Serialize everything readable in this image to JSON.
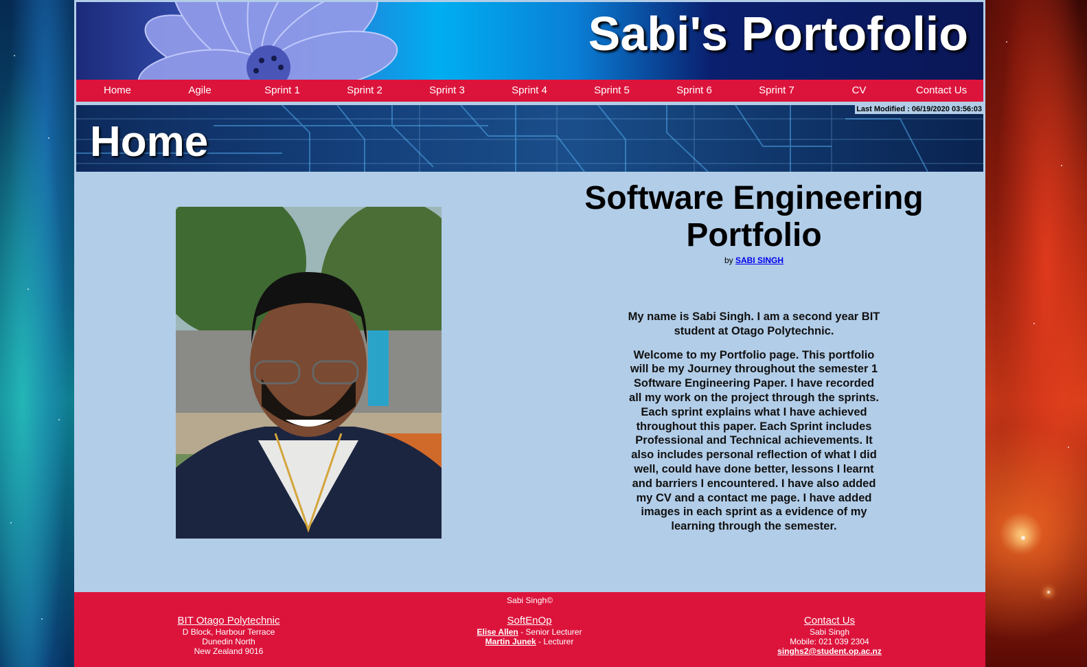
{
  "banner": {
    "title": "Sabi's Portofolio"
  },
  "nav": [
    {
      "label": "Home"
    },
    {
      "label": "Agile"
    },
    {
      "label": "Sprint 1"
    },
    {
      "label": "Sprint 2"
    },
    {
      "label": "Sprint 3"
    },
    {
      "label": "Sprint 4"
    },
    {
      "label": "Sprint 5"
    },
    {
      "label": "Sprint 6"
    },
    {
      "label": "Sprint 7"
    },
    {
      "label": "CV"
    },
    {
      "label": "Contact Us"
    }
  ],
  "hero": {
    "title": "Home",
    "last_modified": "Last Modified : 06/19/2020 03:56:03"
  },
  "content": {
    "heading": "Software Engineering Portfolio",
    "by_prefix": "by",
    "author_link": "SABI SINGH",
    "intro": "My name is Sabi Singh. I am a second year BIT student at Otago Polytechnic.",
    "body": "Welcome to my Portfolio page. This portfolio will be my Journey throughout the semester 1 Software Engineering Paper. I have recorded all my work on the project through the sprints. Each sprint explains what I have achieved throughout this paper. Each Sprint includes Professional and Technical achievements. It also includes personal reflection of what I did well, could have done better, lessons I learnt and barriers I encountered. I have also added my CV and a contact me page. I have added images in each sprint as a evidence of my learning through the semester."
  },
  "footer": {
    "copyright": "Sabi Singh©",
    "col1": {
      "title": "BIT Otago Polytechnic",
      "line1": "D Block, Harbour Terrace",
      "line2": "Dunedin North",
      "line3": "New Zealand 9016"
    },
    "col2": {
      "title": "SoftEnOp",
      "person1": "Elise Allen",
      "role1": " - Senior Lecturer",
      "person2": "Martin Junek",
      "role2": " - Lecturer"
    },
    "col3": {
      "title": "Contact Us",
      "name": "Sabi Singh",
      "mobile": "Mobile: 021 039 2304",
      "email": "singhs2@student.op.ac.nz"
    }
  }
}
